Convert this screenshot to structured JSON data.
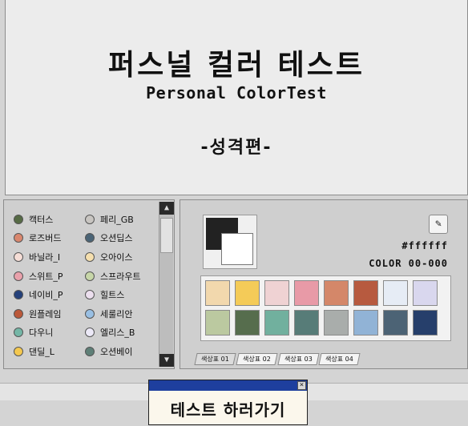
{
  "header": {
    "title_ko": "퍼스널 컬러 테스트",
    "title_en": "Personal ColorTest",
    "part": "-성격편-"
  },
  "palette_list": {
    "col1": [
      {
        "label": "캑터스",
        "color": "#566b45"
      },
      {
        "label": "로즈버드",
        "color": "#d9876e"
      },
      {
        "label": "바닐라_I",
        "color": "#f5ddd6"
      },
      {
        "label": "스위트_P",
        "color": "#e9a1ab"
      },
      {
        "label": "네이비_P",
        "color": "#24407a"
      },
      {
        "label": "원플레임",
        "color": "#bb5839"
      },
      {
        "label": "다우니",
        "color": "#74b6a6"
      },
      {
        "label": "댄딜_L",
        "color": "#f4c84f"
      }
    ],
    "col2": [
      {
        "label": "페리_GB",
        "color": "#c8c5c1"
      },
      {
        "label": "오션딥스",
        "color": "#4a6476"
      },
      {
        "label": "오아이스",
        "color": "#f5dfae"
      },
      {
        "label": "스프라우트",
        "color": "#c7d6a8"
      },
      {
        "label": "힐트스",
        "color": "#ecdfee"
      },
      {
        "label": "세룰리안",
        "color": "#99bfe3"
      },
      {
        "label": "엘리스_B",
        "color": "#ece9f7"
      },
      {
        "label": "오션베이",
        "color": "#5e7f77"
      }
    ]
  },
  "picker": {
    "primary_color": "#222222",
    "secondary_color": "#ffffff",
    "hex": "#ffffff",
    "color_code": "COLOR 00-000",
    "eyedropper_icon": "eyedropper-icon"
  },
  "swatch_grid": [
    "#f2d8ad",
    "#f4cb58",
    "#efd2d3",
    "#e89aa7",
    "#d48769",
    "#b75a3f",
    "#e6ecf5",
    "#d9d7ee",
    "#bbc9a0",
    "#566d4d",
    "#71b09e",
    "#577c78",
    "#a9adab",
    "#91b3d6",
    "#4c6375",
    "#263f6b"
  ],
  "tabs": [
    "색상표 01",
    "색상표 02",
    "색상표 03",
    "색상표 04"
  ],
  "cta": {
    "label": "테스트 하러가기",
    "close_icon": "close-icon"
  },
  "scroll_icons": {
    "up": "triangle-up-icon",
    "down": "triangle-down-icon"
  }
}
